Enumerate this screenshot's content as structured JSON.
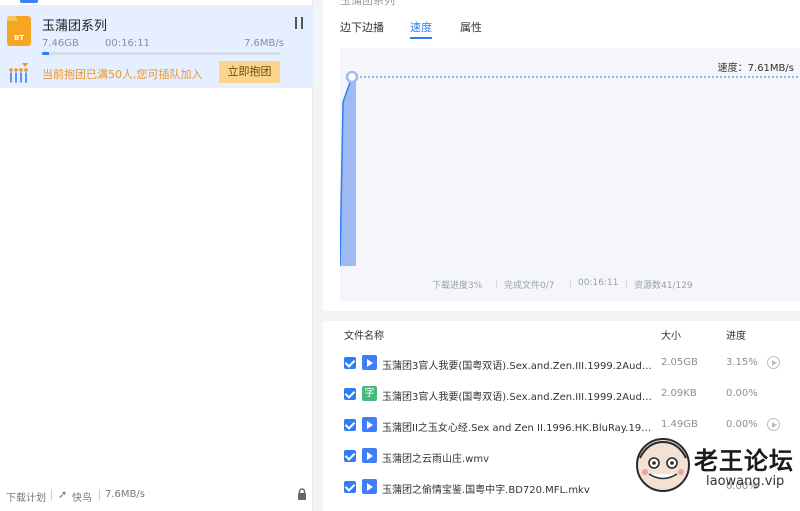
{
  "task": {
    "title": "玉蒲团系列",
    "file_icon_label": "BT",
    "downloaded_size": "7.46GB",
    "elapsed": "00:16:11",
    "speed": "7.6MB/s",
    "progress_fraction": 0.03,
    "team_text": "当前抱团已满50人,您可插队加入",
    "join_button": "立即抱团"
  },
  "left_bottom": {
    "plan": "下载计划",
    "fast_icon": "rocket-icon",
    "fast": "快鸟",
    "speed": "7.6MB/s"
  },
  "detail": {
    "title_clipped": "玉蒲团系列",
    "tabs": [
      "边下边播",
      "速度",
      "属性"
    ],
    "active_tab": "速度",
    "speed_label": "速度：7.61MB/s",
    "footer": {
      "progress": "下载进度3%",
      "files": "完成文件0/7",
      "time": "00:16:11",
      "resources": "资源数41/129"
    }
  },
  "chart_data": {
    "type": "area",
    "title": "",
    "xlabel": "",
    "ylabel": "",
    "series": [
      {
        "values": [
          0,
          6.6,
          7.61,
          7.61,
          7.61
        ]
      }
    ],
    "current_value_label": "速度：7.61MB/s",
    "grid": false
  },
  "file_list": {
    "headers": {
      "name": "文件名称",
      "size": "大小",
      "progress": "进度"
    },
    "rows": [
      {
        "type": "video",
        "name": "玉蒲团3官人我要(国粤双语).Sex.and.Zen.III.1999.2Audio...",
        "size": "2.05GB",
        "progress": "3.15%",
        "playable": true
      },
      {
        "type": "subtitle",
        "type_glyph": "字",
        "name": "玉蒲团3官人我要(国粤双语).Sex.and.Zen.III.1999.2Audio...",
        "size": "2.09KB",
        "progress": "0.00%",
        "playable": false
      },
      {
        "type": "video",
        "name": "玉蒲团II之玉女心经.Sex and Zen II.1996.HK.BluRay.192...",
        "size": "1.49GB",
        "progress": "0.00%",
        "playable": true
      },
      {
        "type": "video",
        "name": "玉蒲团之云雨山庄.wmv",
        "size": "",
        "progress": "",
        "playable": false
      },
      {
        "type": "video",
        "name": "玉蒲团之偷情宝鉴.国粤中字.BD720.MFL.mkv",
        "size": "GB",
        "progress": "0.00%",
        "playable": false
      }
    ]
  },
  "watermark": {
    "text": "老王论坛",
    "url": "laowang.vip"
  },
  "colors": {
    "accent": "#2f7cf6",
    "selected_bg": "#e5efff",
    "warning": "#e8962c",
    "join_btn": "#fbd58a"
  }
}
